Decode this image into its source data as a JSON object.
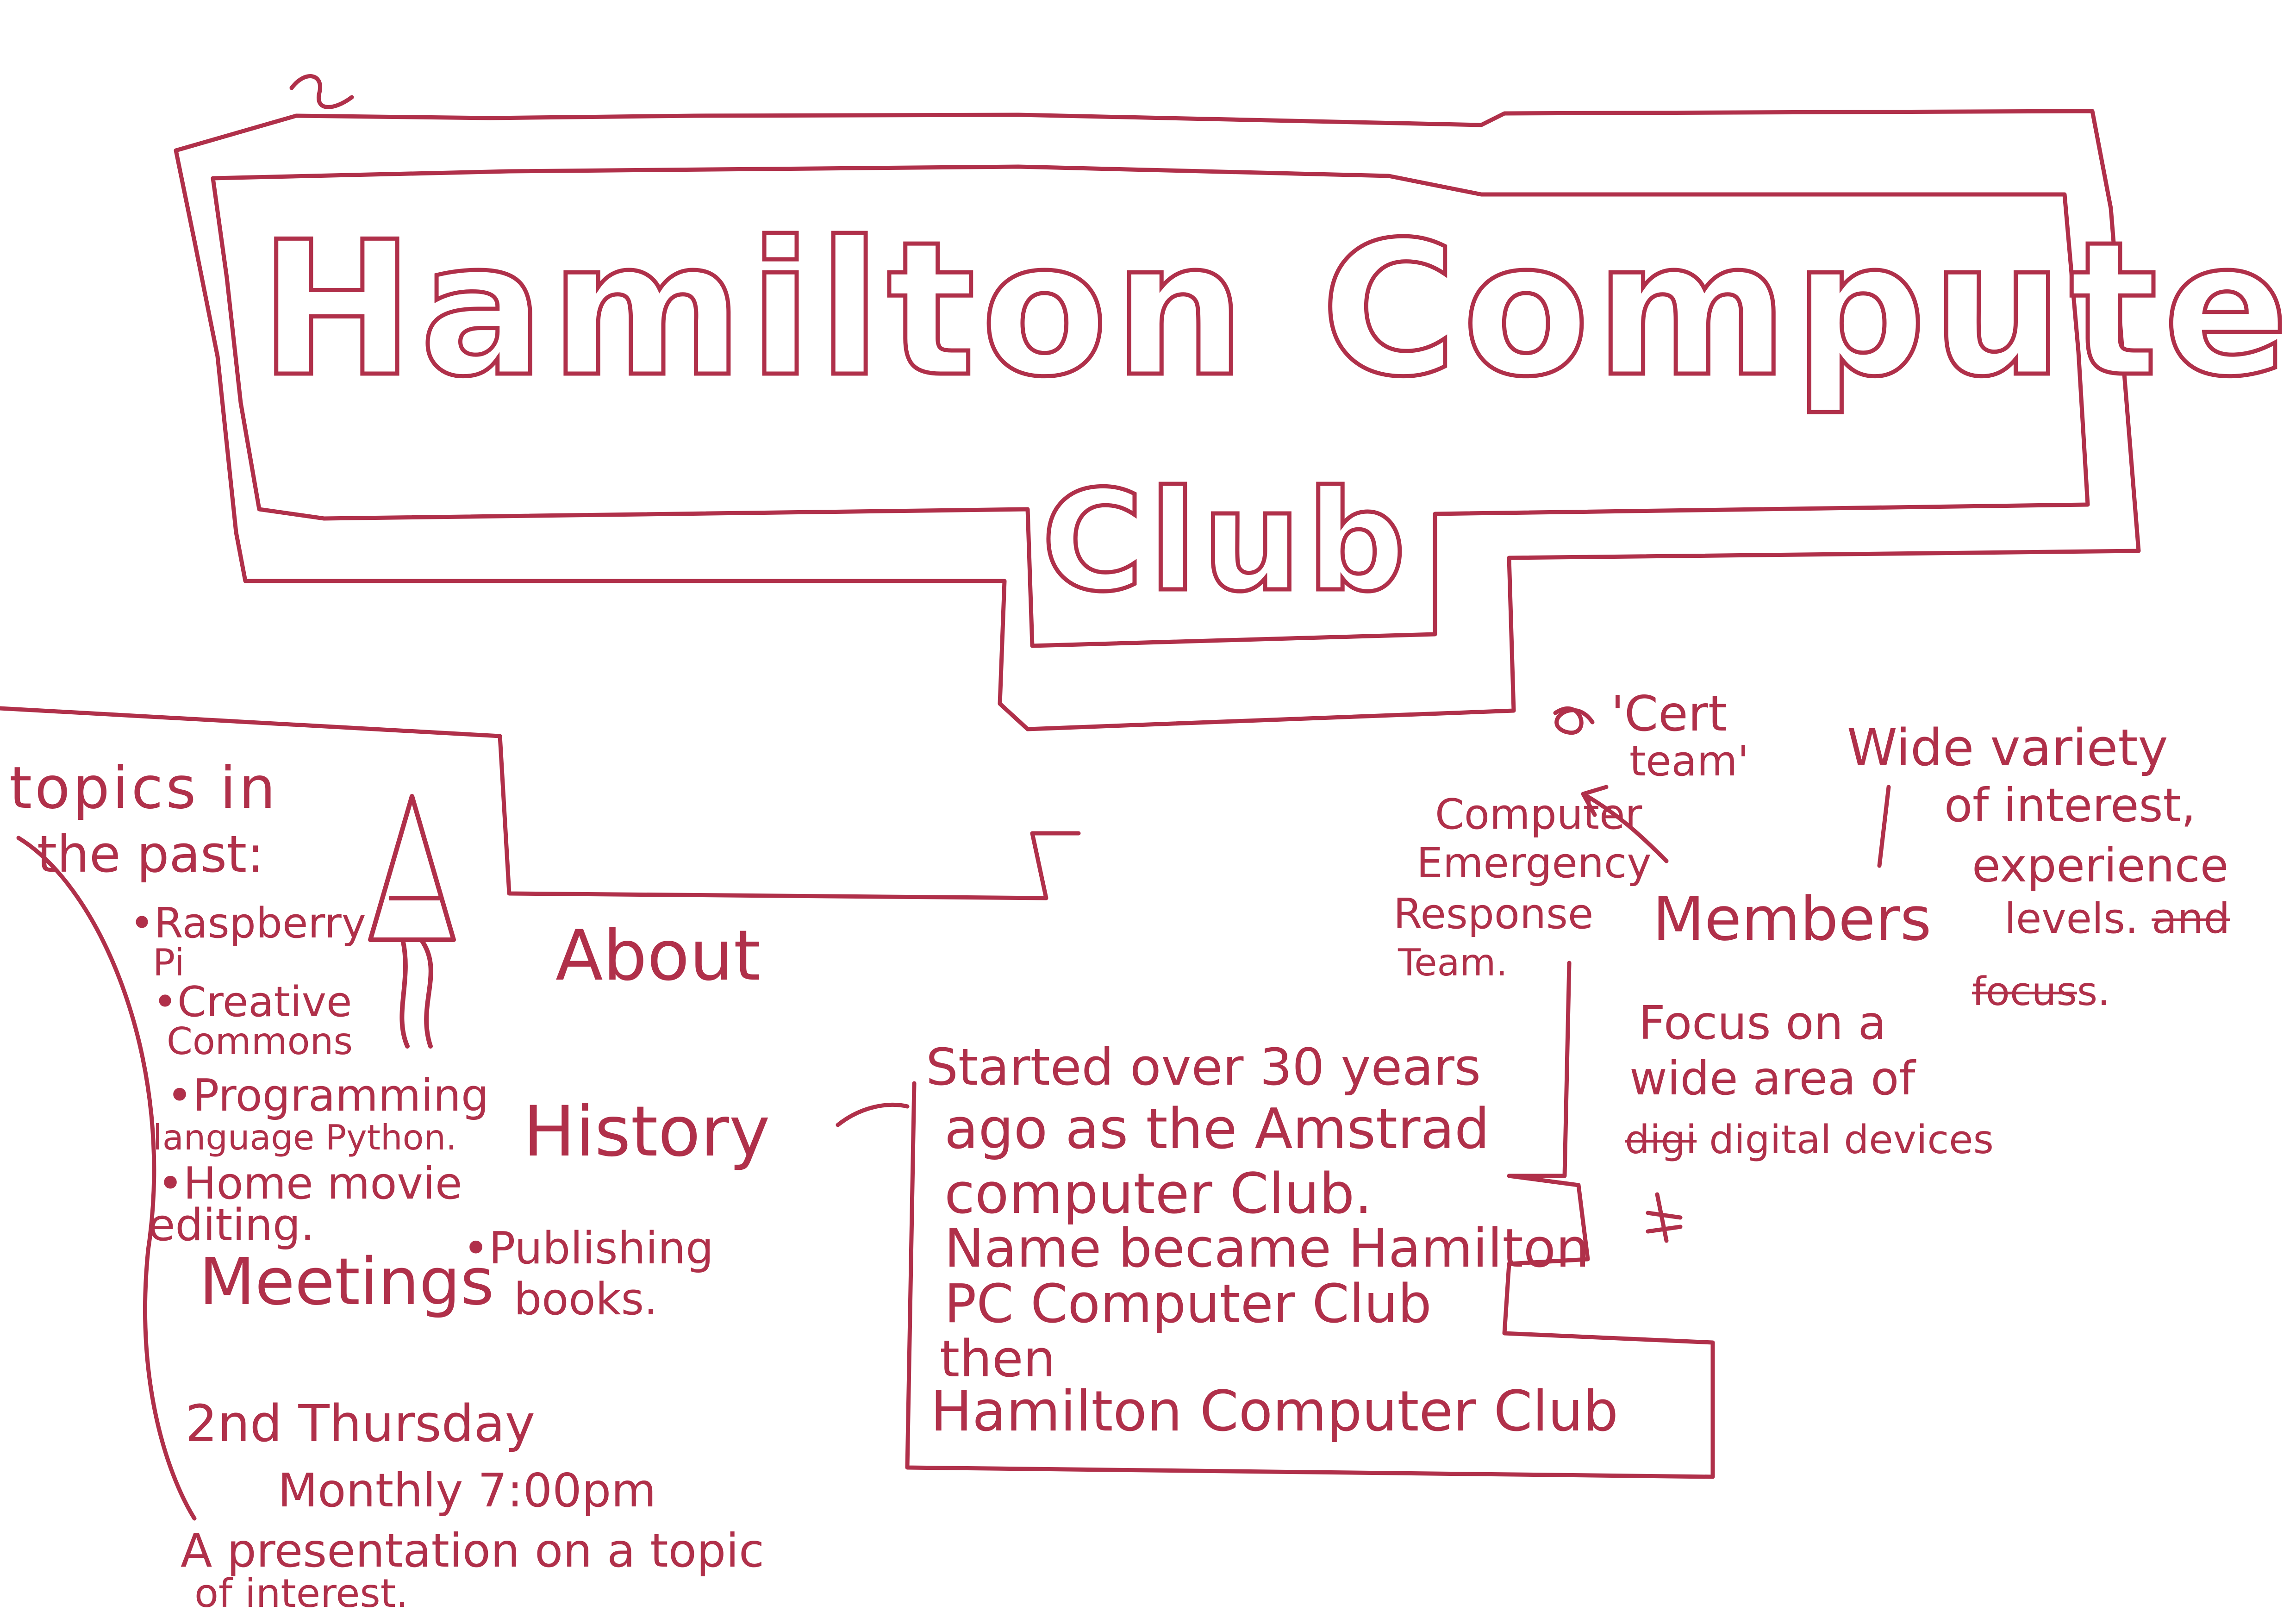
{
  "accent_color": "#b0304a",
  "banner": {
    "title_line1": "Hamilton Computer",
    "title_line2": "Club"
  },
  "about": {
    "label": "About"
  },
  "topics": {
    "heading_line1": "topics   in",
    "heading_line2": "the past:",
    "items": [
      "•Raspberry",
      "Pi",
      "•Creative",
      "Commons",
      "•Programming",
      "language  Python.",
      "•Home  movie",
      "editing."
    ],
    "python_glyph": "python-logo-icon"
  },
  "history": {
    "label": "History",
    "lines": [
      "Started over 30 years",
      "ago as the Amstrad",
      "computer Club.",
      "Name became Hamilton",
      "PC Computer Club",
      "then",
      "Hamilton  Computer Club"
    ]
  },
  "meetings": {
    "label": "Meetings",
    "publishing_line1": "•Publishing",
    "publishing_line2": "books.",
    "schedule_day": "2nd  Thursday",
    "schedule_time": "Monthly   7:00pm",
    "presentation_line1": "A presentation on a topic",
    "presentation_line2": "of  interest."
  },
  "members": {
    "label": "Members",
    "cert_line1": "'Cert",
    "cert_line2": "team'",
    "cert_meaning": [
      "Computer",
      "Emergency",
      "Response",
      "Team."
    ],
    "variety_line1": "Wide  variety",
    "variety_line2": "of  interest,",
    "variety_line3": "experience",
    "variety_line4": "levels.",
    "variety_struck1": "and",
    "variety_struck2": "focus",
    "variety_end": "s.",
    "focus_lines": [
      "Focus  on  a",
      "wide  area  of"
    ],
    "focus_struck": "digi",
    "focus_end": "digital devices"
  }
}
